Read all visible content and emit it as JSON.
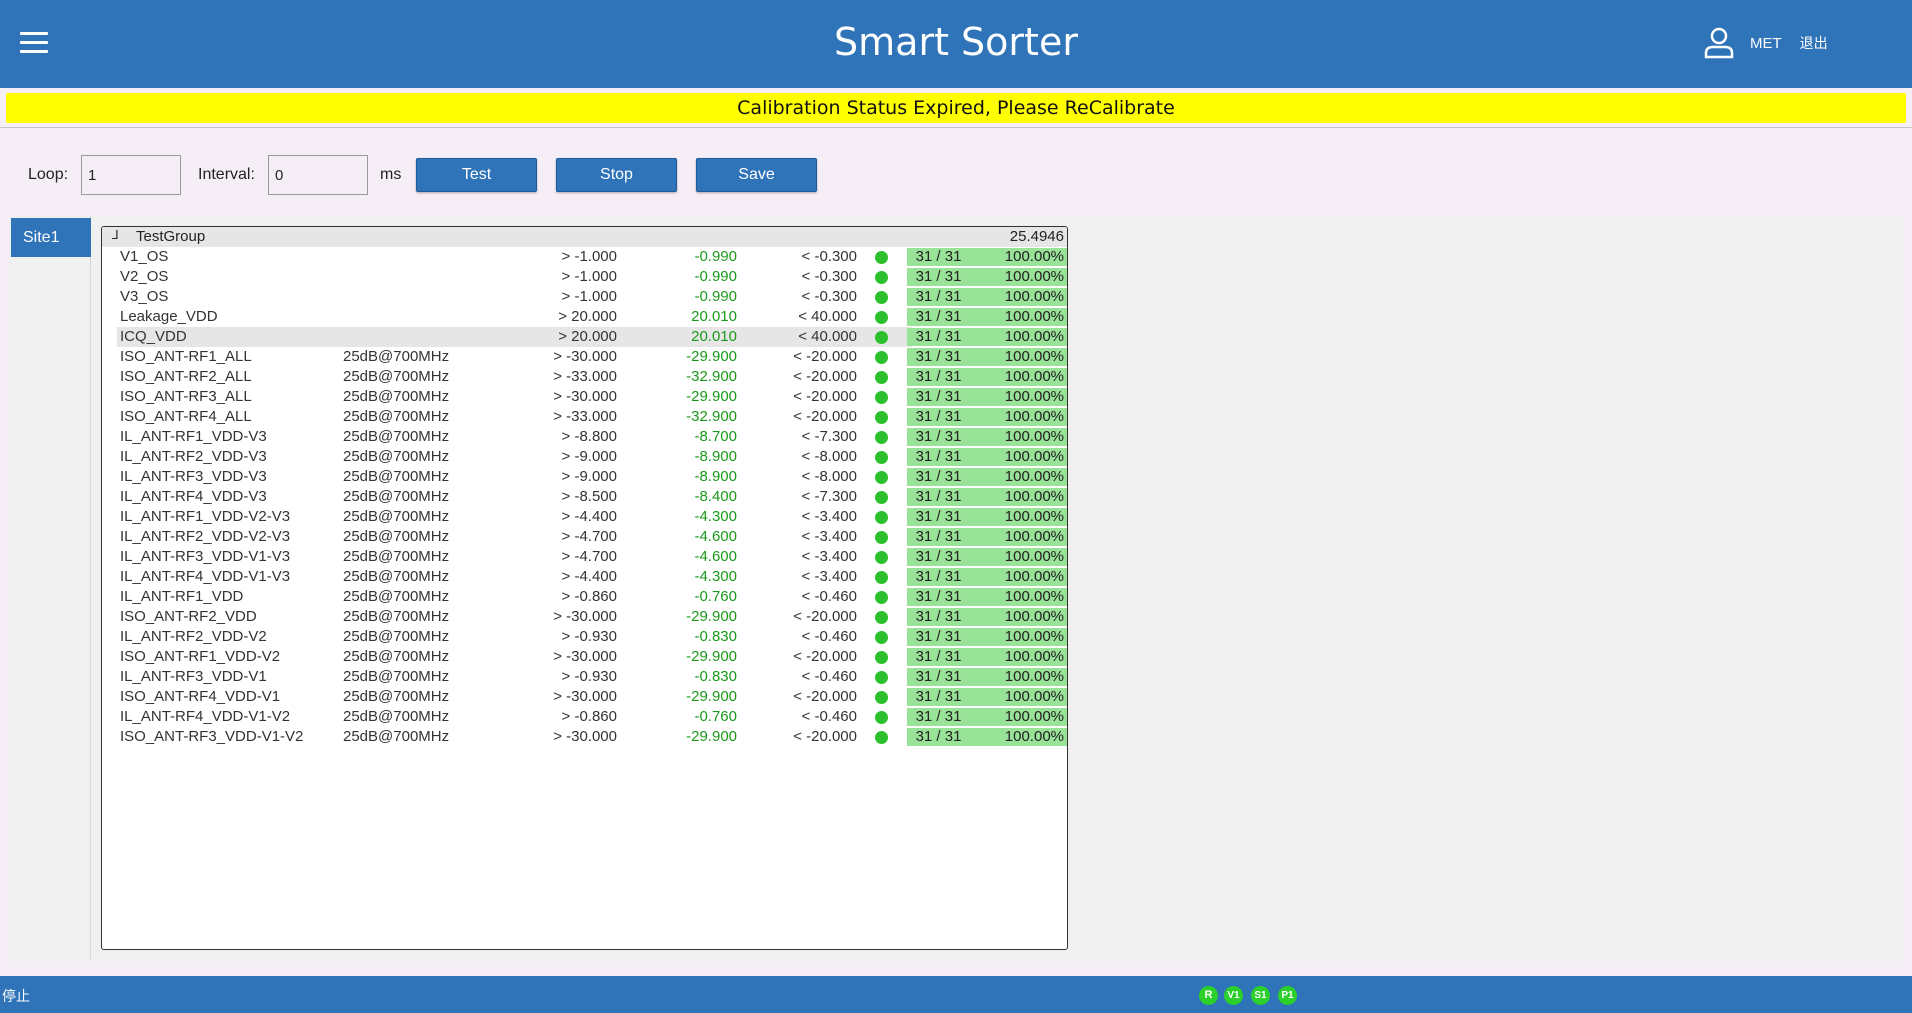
{
  "header": {
    "title": "Smart Sorter",
    "user": "MET",
    "logout": "退出"
  },
  "banner": {
    "text": "Calibration Status Expired, Please ReCalibrate"
  },
  "controls": {
    "loop_label": "Loop:",
    "loop_value": "1",
    "interval_label": "Interval:",
    "interval_value": "0",
    "unit": "ms",
    "test_label": "Test",
    "stop_label": "Stop",
    "save_label": "Save"
  },
  "sites": [
    {
      "label": "Site1"
    }
  ],
  "group": {
    "toggle": "⅃",
    "name": "TestGroup",
    "time": "25.4946"
  },
  "rows": [
    {
      "name": "V1_OS",
      "cond": "",
      "low": "> -1.000",
      "value": "-0.990",
      "high": "< -0.300",
      "count": "31 / 31",
      "pct": "100.00%"
    },
    {
      "name": "V2_OS",
      "cond": "",
      "low": "> -1.000",
      "value": "-0.990",
      "high": "< -0.300",
      "count": "31 / 31",
      "pct": "100.00%"
    },
    {
      "name": "V3_OS",
      "cond": "",
      "low": "> -1.000",
      "value": "-0.990",
      "high": "< -0.300",
      "count": "31 / 31",
      "pct": "100.00%"
    },
    {
      "name": "Leakage_VDD",
      "cond": "",
      "low": "> 20.000",
      "value": "20.010",
      "high": "< 40.000",
      "count": "31 / 31",
      "pct": "100.00%"
    },
    {
      "name": "ICQ_VDD",
      "cond": "",
      "low": "> 20.000",
      "value": "20.010",
      "high": "< 40.000",
      "count": "31 / 31",
      "pct": "100.00%"
    },
    {
      "name": "ISO_ANT-RF1_ALL",
      "cond": "25dB@700MHz",
      "low": "> -30.000",
      "value": "-29.900",
      "high": "< -20.000",
      "count": "31 / 31",
      "pct": "100.00%"
    },
    {
      "name": "ISO_ANT-RF2_ALL",
      "cond": "25dB@700MHz",
      "low": "> -33.000",
      "value": "-32.900",
      "high": "< -20.000",
      "count": "31 / 31",
      "pct": "100.00%"
    },
    {
      "name": "ISO_ANT-RF3_ALL",
      "cond": "25dB@700MHz",
      "low": "> -30.000",
      "value": "-29.900",
      "high": "< -20.000",
      "count": "31 / 31",
      "pct": "100.00%"
    },
    {
      "name": "ISO_ANT-RF4_ALL",
      "cond": "25dB@700MHz",
      "low": "> -33.000",
      "value": "-32.900",
      "high": "< -20.000",
      "count": "31 / 31",
      "pct": "100.00%"
    },
    {
      "name": "IL_ANT-RF1_VDD-V3",
      "cond": "25dB@700MHz",
      "low": "> -8.800",
      "value": "-8.700",
      "high": "< -7.300",
      "count": "31 / 31",
      "pct": "100.00%"
    },
    {
      "name": "IL_ANT-RF2_VDD-V3",
      "cond": "25dB@700MHz",
      "low": "> -9.000",
      "value": "-8.900",
      "high": "< -8.000",
      "count": "31 / 31",
      "pct": "100.00%"
    },
    {
      "name": "IL_ANT-RF3_VDD-V3",
      "cond": "25dB@700MHz",
      "low": "> -9.000",
      "value": "-8.900",
      "high": "< -8.000",
      "count": "31 / 31",
      "pct": "100.00%"
    },
    {
      "name": "IL_ANT-RF4_VDD-V3",
      "cond": "25dB@700MHz",
      "low": "> -8.500",
      "value": "-8.400",
      "high": "< -7.300",
      "count": "31 / 31",
      "pct": "100.00%"
    },
    {
      "name": "IL_ANT-RF1_VDD-V2-V3",
      "cond": "25dB@700MHz",
      "low": "> -4.400",
      "value": "-4.300",
      "high": "< -3.400",
      "count": "31 / 31",
      "pct": "100.00%"
    },
    {
      "name": "IL_ANT-RF2_VDD-V2-V3",
      "cond": "25dB@700MHz",
      "low": "> -4.700",
      "value": "-4.600",
      "high": "< -3.400",
      "count": "31 / 31",
      "pct": "100.00%"
    },
    {
      "name": "IL_ANT-RF3_VDD-V1-V3",
      "cond": "25dB@700MHz",
      "low": "> -4.700",
      "value": "-4.600",
      "high": "< -3.400",
      "count": "31 / 31",
      "pct": "100.00%"
    },
    {
      "name": "IL_ANT-RF4_VDD-V1-V3",
      "cond": "25dB@700MHz",
      "low": "> -4.400",
      "value": "-4.300",
      "high": "< -3.400",
      "count": "31 / 31",
      "pct": "100.00%"
    },
    {
      "name": "IL_ANT-RF1_VDD",
      "cond": "25dB@700MHz",
      "low": "> -0.860",
      "value": "-0.760",
      "high": "< -0.460",
      "count": "31 / 31",
      "pct": "100.00%"
    },
    {
      "name": "ISO_ANT-RF2_VDD",
      "cond": "25dB@700MHz",
      "low": "> -30.000",
      "value": "-29.900",
      "high": "< -20.000",
      "count": "31 / 31",
      "pct": "100.00%"
    },
    {
      "name": "IL_ANT-RF2_VDD-V2",
      "cond": "25dB@700MHz",
      "low": "> -0.930",
      "value": "-0.830",
      "high": "< -0.460",
      "count": "31 / 31",
      "pct": "100.00%"
    },
    {
      "name": "ISO_ANT-RF1_VDD-V2",
      "cond": "25dB@700MHz",
      "low": "> -30.000",
      "value": "-29.900",
      "high": "< -20.000",
      "count": "31 / 31",
      "pct": "100.00%"
    },
    {
      "name": "IL_ANT-RF3_VDD-V1",
      "cond": "25dB@700MHz",
      "low": "> -0.930",
      "value": "-0.830",
      "high": "< -0.460",
      "count": "31 / 31",
      "pct": "100.00%"
    },
    {
      "name": "ISO_ANT-RF4_VDD-V1",
      "cond": "25dB@700MHz",
      "low": "> -30.000",
      "value": "-29.900",
      "high": "< -20.000",
      "count": "31 / 31",
      "pct": "100.00%"
    },
    {
      "name": "IL_ANT-RF4_VDD-V1-V2",
      "cond": "25dB@700MHz",
      "low": "> -0.860",
      "value": "-0.760",
      "high": "< -0.460",
      "count": "31 / 31",
      "pct": "100.00%"
    },
    {
      "name": "ISO_ANT-RF3_VDD-V1-V2",
      "cond": "25dB@700MHz",
      "low": "> -30.000",
      "value": "-29.900",
      "high": "< -20.000",
      "count": "31 / 31",
      "pct": "100.00%"
    }
  ],
  "footer": {
    "status": "停止",
    "indicators": [
      "R",
      "V1",
      "S1",
      "P1"
    ]
  },
  "colors": {
    "primary": "#2f73b8",
    "banner": "#ffff00",
    "pass": "#2bc02b",
    "pass_bg": "#98e398",
    "value_text": "#1a9a1a"
  }
}
